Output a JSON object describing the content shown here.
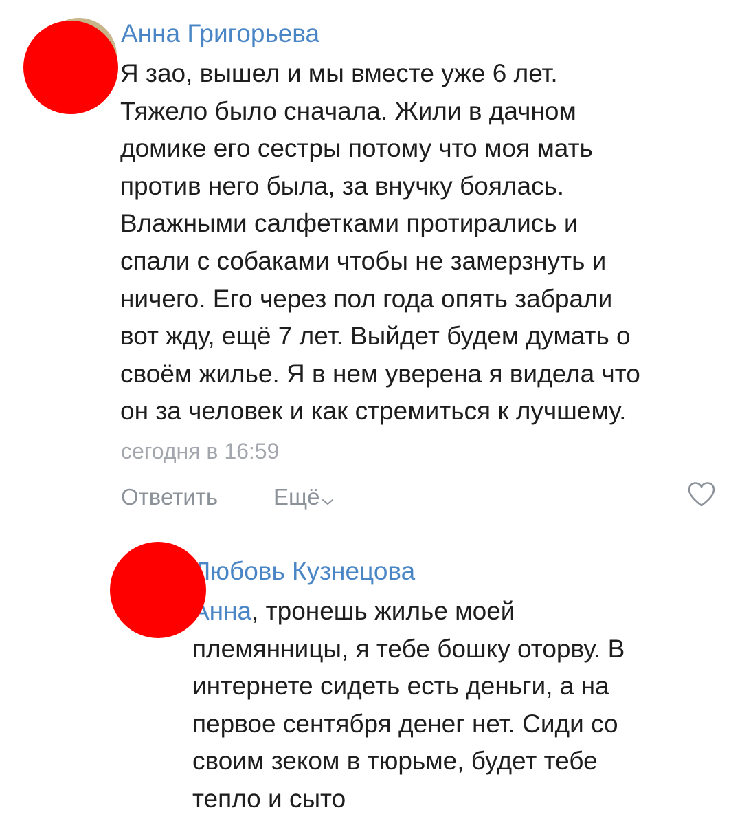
{
  "comments": [
    {
      "author": "Анна Григорьева",
      "text_lines": [
        "Я зао, вышел и мы вместе уже 6 лет.",
        "Тяжело было сначала. Жили в дачном",
        "домике его сестры потому что моя мать",
        "против него была, за внучку боялась.",
        "Влажными салфетками протирались и",
        "спали с собаками чтобы не замерзнуть и",
        "ничего. Его через пол года опять забрали",
        "вот жду, ещё 7 лет. Выйдет будем думать о",
        "своём жилье. Я в нем уверена я видела что",
        "он за человек и как стремиться к лучшему."
      ],
      "time": "сегодня в 16:59",
      "reply_label": "Ответить",
      "more_label": "Ещё",
      "like_icon": "heart-outline-icon",
      "avatar_color": "#ff0000"
    },
    {
      "author": "Любовь Кузнецова",
      "mention": "Анна",
      "text_lines": [
        ", тронешь жилье моей",
        "племянницы, я тебе бошку оторву. В",
        "интернете сидеть есть деньги, а на",
        "первое сентября денег нет. Сиди со",
        "своим зеком в тюрьме, будет тебе",
        "тепло и сыто"
      ],
      "avatar_color": "#ff0000"
    }
  ],
  "colors": {
    "author": "#4a86c5",
    "text": "#1e1e1e",
    "meta": "#a3a7ad",
    "action": "#8c9299",
    "avatar_redaction": "#ff0000"
  }
}
